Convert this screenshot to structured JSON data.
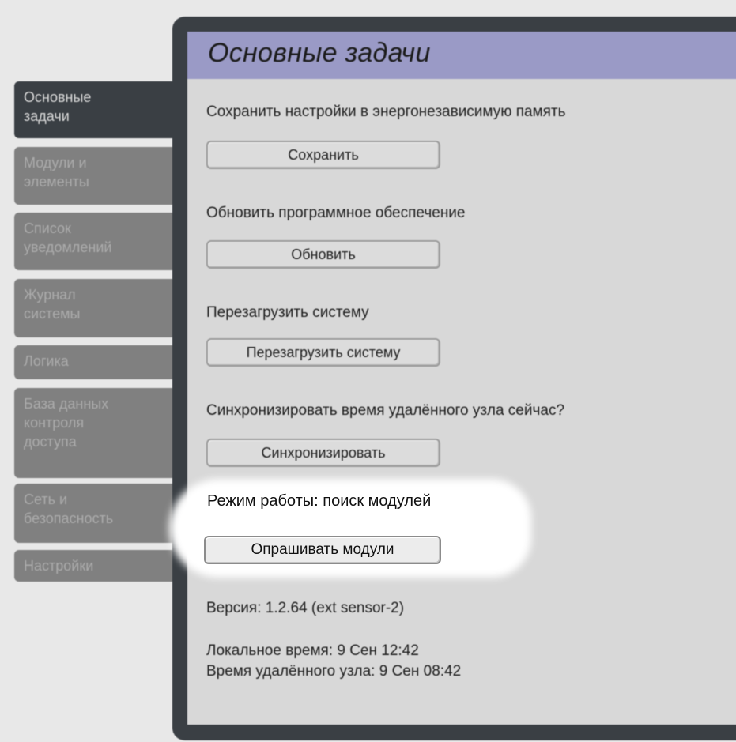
{
  "sidebar": {
    "items": [
      {
        "label": "Основные\nзадачи",
        "active": true
      },
      {
        "label": "Модули и\nэлементы",
        "active": false
      },
      {
        "label": "Список\nуведомлений",
        "active": false
      },
      {
        "label": "Журнал\nсистемы",
        "active": false
      },
      {
        "label": "Логика",
        "active": false
      },
      {
        "label": "База данных\nконтроля\nдоступа",
        "active": false
      },
      {
        "label": "Сеть и\nбезопасность",
        "active": false
      },
      {
        "label": "Настройки",
        "active": false
      }
    ]
  },
  "panel": {
    "title": "Основные задачи",
    "save": {
      "label": "Сохранить настройки в энергонезависимую память",
      "button": "Сохранить"
    },
    "update": {
      "label": "Обновить программное обеспечение",
      "button": "Обновить"
    },
    "reboot": {
      "label": "Перезагрузить систему",
      "button": "Перезагрузить систему"
    },
    "sync": {
      "label": "Синхронизировать время удалённого узла сейчас?",
      "button": "Синхронизировать"
    },
    "mode": {
      "label": "Режим работы: поиск модулей",
      "button": "Опрашивать модули"
    },
    "version": "Версия: 1.2.64 (ext sensor-2)",
    "local_time": "Локальное время: 9 Сен 12:42",
    "remote_time": "Время удалённого узла: 9 Сен 08:42"
  },
  "colors": {
    "page_bg": "#e8e8e8",
    "panel_frame": "#3a3f44",
    "panel_bg": "#d8d8d8",
    "header_bg": "#9a9ac6",
    "sidebar_item_bg": "#808080",
    "sidebar_item_active_bg": "#3a3f44",
    "highlight": "#ffffff"
  }
}
